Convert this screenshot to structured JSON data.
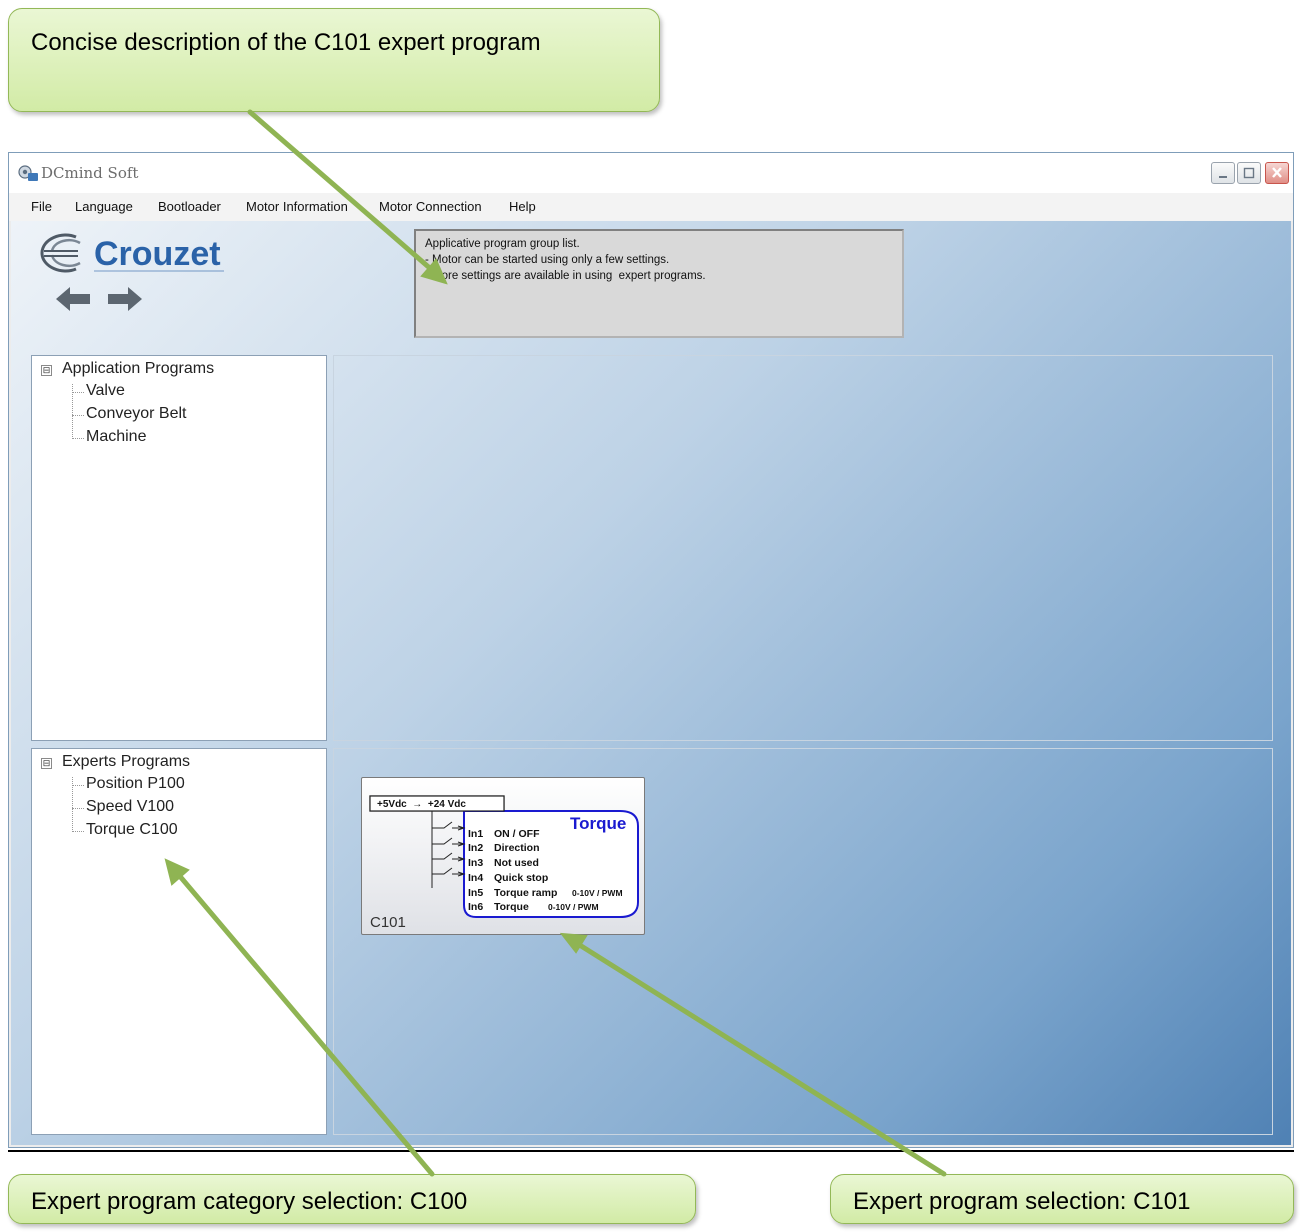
{
  "callouts": {
    "top": "Concise description of the C101 expert program",
    "bottom_left": "Expert program category selection: C100",
    "bottom_right": "Expert program selection: C101"
  },
  "window": {
    "title": "DCmind Soft",
    "controls": [
      "minimize",
      "maximize",
      "close"
    ]
  },
  "menu": [
    "File",
    "Language",
    "Bootloader",
    "Motor Information",
    "Motor Connection",
    "Help"
  ],
  "brand": {
    "name": "Crouzet",
    "color": "#2a62a8"
  },
  "description": {
    "lines": [
      "Applicative program group list.",
      "- Motor can be started using only a few settings.",
      "- More settings are available in using  expert programs."
    ]
  },
  "tree_applications": {
    "root": "Application Programs",
    "toggle": "⊟",
    "items": [
      "Valve",
      "Conveyor Belt",
      "Machine"
    ]
  },
  "tree_experts": {
    "root": "Experts Programs",
    "toggle": "⊟",
    "items": [
      "Position P100",
      "Speed V100",
      "Torque C100"
    ]
  },
  "program_card": {
    "label": "C101",
    "title": "Torque",
    "supply": "+5Vdc  →  +24 Vdc",
    "inputs": [
      {
        "pin": "In1",
        "name": "ON / OFF",
        "note": ""
      },
      {
        "pin": "In2",
        "name": "Direction",
        "note": ""
      },
      {
        "pin": "In3",
        "name": "Not used",
        "note": ""
      },
      {
        "pin": "In4",
        "name": "Quick stop",
        "note": ""
      },
      {
        "pin": "In5",
        "name": "Torque ramp",
        "note": "0-10V / PWM"
      },
      {
        "pin": "In6",
        "name": "Torque",
        "note": "0-10V / PWM"
      }
    ]
  },
  "colors": {
    "callout_fill": "#dbefb8",
    "arrow": "#8fb453",
    "card_accent": "#1a1ad0"
  }
}
